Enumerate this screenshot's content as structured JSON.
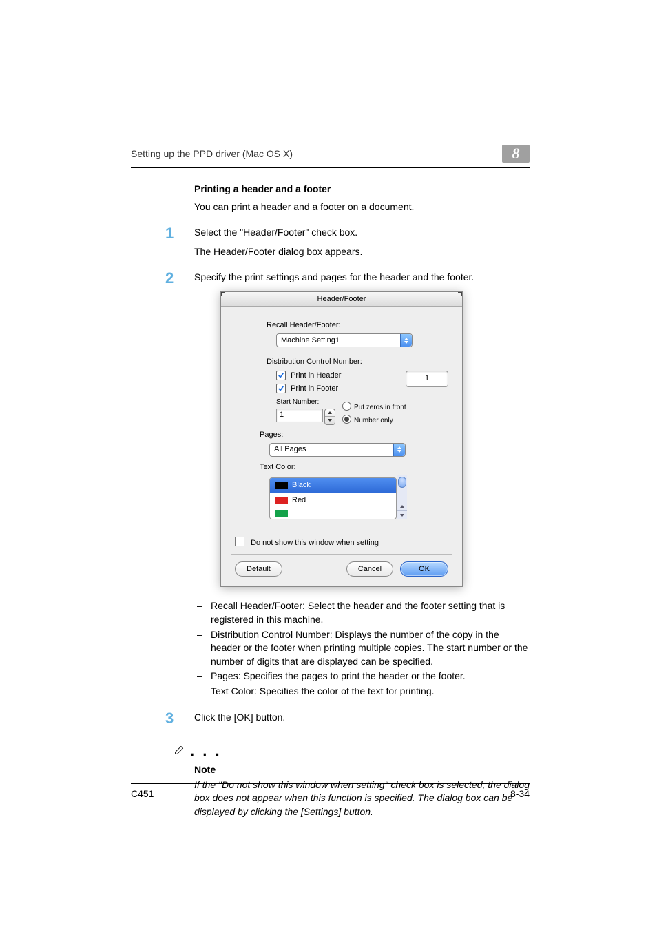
{
  "running_head": "Setting up the PPD driver (Mac OS X)",
  "chapter_number": "8",
  "section": {
    "title": "Printing a header and a footer",
    "intro": "You can print a header and a footer on a document."
  },
  "steps": {
    "s1": {
      "num": "1",
      "line1": "Select the \"Header/Footer\" check box.",
      "line2": "The Header/Footer dialog box appears."
    },
    "s2": {
      "num": "2",
      "line1": "Specify the print settings and pages for the header and the footer."
    },
    "s3": {
      "num": "3",
      "line1": "Click the [OK] button."
    }
  },
  "dialog": {
    "title": "Header/Footer",
    "recall_label": "Recall Header/Footer:",
    "recall_value": "Machine Setting1",
    "dist_label": "Distribution Control Number:",
    "print_header": "Print in Header",
    "print_footer": "Print in Footer",
    "count_value": "1",
    "start_label": "Start Number:",
    "start_value": "1",
    "radio_zeros": "Put zeros in front",
    "radio_number": "Number only",
    "pages_label": "Pages:",
    "pages_value": "All Pages",
    "textcolor_label": "Text Color:",
    "color_black": "Black",
    "color_red": "Red",
    "dont_show": "Do not show this window when setting",
    "btn_default": "Default",
    "btn_cancel": "Cancel",
    "btn_ok": "OK"
  },
  "bullets": {
    "b1": "Recall Header/Footer: Select the header and the footer setting that is registered in this machine.",
    "b2": "Distribution Control Number: Displays the number of the copy in the header or the footer when printing multiple copies. The start number or the number of digits that are displayed can be specified.",
    "b3": "Pages: Specifies the pages to print the header or the footer.",
    "b4": "Text Color: Specifies the color of the text for printing."
  },
  "note": {
    "label": "Note",
    "text": "If the \"Do not show this window when setting\" check box is selected, the dialog box does not appear when this function is specified. The dialog box can be displayed by clicking the [Settings] button."
  },
  "footer": {
    "model": "C451",
    "pagenum": "8-34"
  }
}
